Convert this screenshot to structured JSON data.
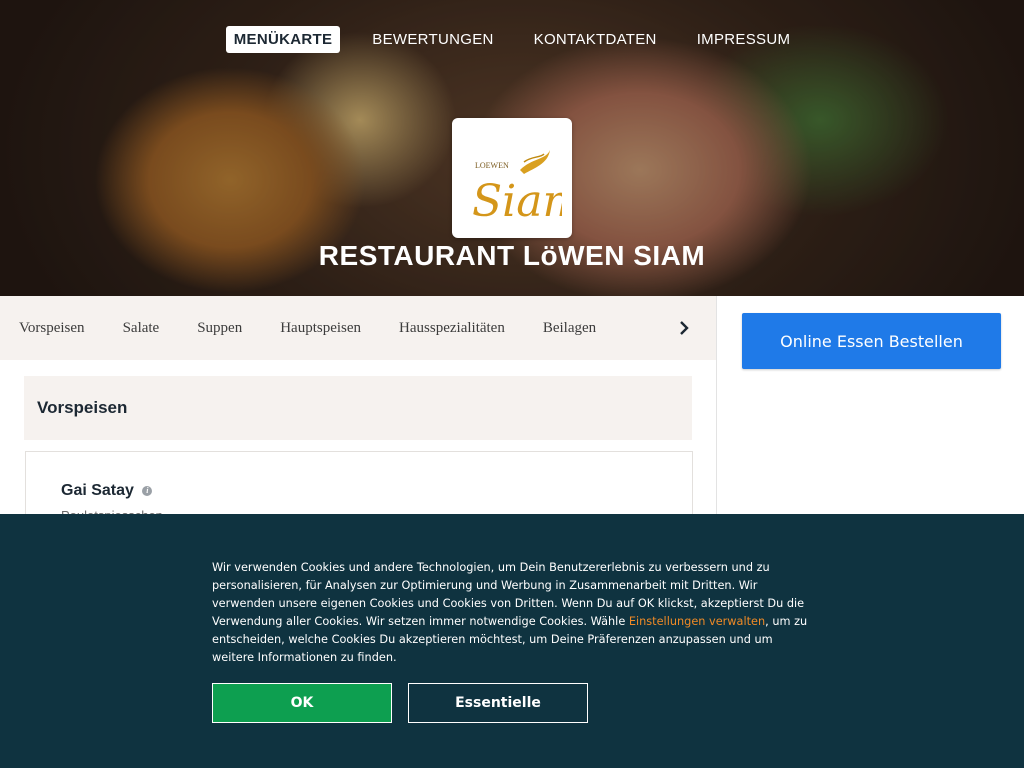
{
  "nav": {
    "items": [
      {
        "label": "MENÜKARTE",
        "active": true
      },
      {
        "label": "BEWERTUNGEN",
        "active": false
      },
      {
        "label": "KONTAKTDATEN",
        "active": false
      },
      {
        "label": "IMPRESSUM",
        "active": false
      }
    ]
  },
  "logo": {
    "small_text": "LOEWEN",
    "script_text": "Siam",
    "icon": "siam-logo-icon"
  },
  "restaurant": {
    "title": "RESTAURANT LöWEN SIAM"
  },
  "categories": {
    "items": [
      "Vorspeisen",
      "Salate",
      "Suppen",
      "Hauptspeisen",
      "Hausspezialitäten",
      "Beilagen"
    ],
    "next_icon": "chevron-right-icon"
  },
  "order": {
    "button_label": "Online Essen Bestellen",
    "color": "#1f7ae8"
  },
  "menu": {
    "section_title": "Vorspeisen",
    "item": {
      "name": "Gai Satay",
      "description": "Pouletspiesschen",
      "info_icon": "info-icon"
    }
  },
  "cookie": {
    "text_before": "Wir verwenden Cookies und andere Technologien, um Dein Benutzererlebnis zu verbessern und zu personalisieren, für Analysen zur Optimierung und Werbung in Zusammenarbeit mit Dritten. Wir verwenden unsere eigenen Cookies und Cookies von Dritten. Wenn Du auf OK klickst, akzeptierst Du die Verwendung aller Cookies. Wir setzen immer notwendige Cookies. Wähle ",
    "link_text": "Einstellungen verwalten",
    "text_after": ", um zu entscheiden, welche Cookies Du akzeptieren möchtest, um Deine Präferenzen anzupassen und um weitere Informationen zu finden.",
    "ok_label": "OK",
    "essential_label": "Essentielle",
    "colors": {
      "background": "#0f3340",
      "ok": "#0d9f50",
      "link": "#ef8a26"
    }
  }
}
